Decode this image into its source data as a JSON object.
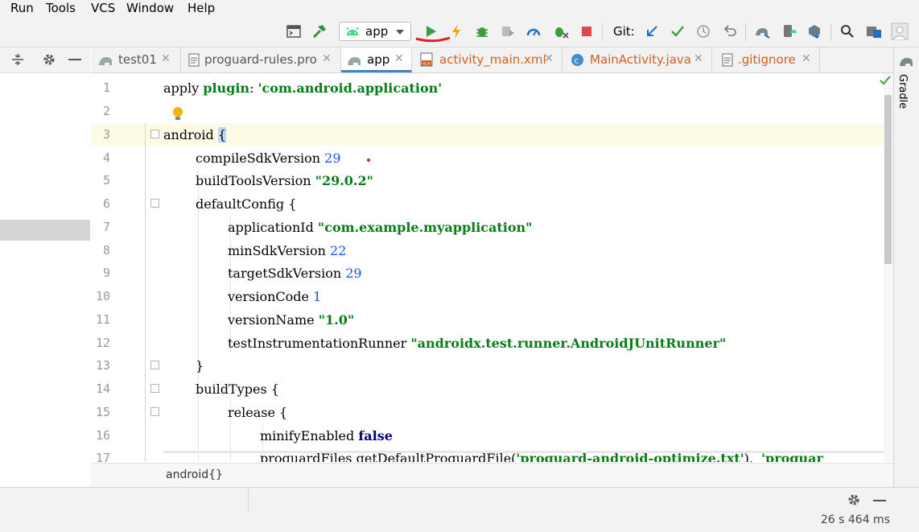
{
  "menu": [
    "Run",
    "Tools",
    "VCS",
    "Window",
    "Help"
  ],
  "toolbar": {
    "run_config": "app",
    "git_label": "Git:"
  },
  "tabs": [
    {
      "label": "test01",
      "icon": "gradle-elephant-icon",
      "active": false
    },
    {
      "label": "proguard-rules.pro",
      "icon": "file-icon",
      "active": false
    },
    {
      "label": "app",
      "icon": "gradle-elephant-icon",
      "active": true
    },
    {
      "label": "activity_main.xml",
      "icon": "xml-layout-icon",
      "active": false
    },
    {
      "label": "MainActivity.java",
      "icon": "java-class-icon",
      "active": false
    },
    {
      "label": ".gitignore",
      "icon": "file-icon",
      "active": false
    }
  ],
  "right_strip": {
    "gradle": "Gradle"
  },
  "editor": {
    "line_numbers": [
      "1",
      "2",
      "3",
      "4",
      "5",
      "6",
      "7",
      "8",
      "9",
      "10",
      "11",
      "12",
      "13",
      "14",
      "15",
      "16",
      "17"
    ],
    "lines": {
      "l1_a": "apply ",
      "l1_b": "plugin",
      "l1_c": ": ",
      "l1_d": "'com.android.application'",
      "l3_a": "android ",
      "l3_b": "{",
      "l4_a": "compileSdkVersion ",
      "l4_b": "29",
      "l5_a": "buildToolsVersion ",
      "l5_b": "\"29.0.2\"",
      "l6_a": "defaultConfig {",
      "l7_a": "applicationId ",
      "l7_b": "\"com.example.myapplication\"",
      "l8_a": "minSdkVersion ",
      "l8_b": "22",
      "l9_a": "targetSdkVersion ",
      "l9_b": "29",
      "l10_a": "versionCode ",
      "l10_b": "1",
      "l11_a": "versionName ",
      "l11_b": "\"1.0\"",
      "l12_a": "testInstrumentationRunner ",
      "l12_b": "\"androidx.test.runner.AndroidJUnitRunner\"",
      "l13_a": "}",
      "l14_a": "buildTypes {",
      "l15_a": "release {",
      "l16_a": "minifyEnabled ",
      "l16_b": "false",
      "l17_a": "proguardFiles getDefaultProguardFile(",
      "l17_b": "'proguard-android-optimize.txt'",
      "l17_c": "),  ",
      "l17_d": "'proguar"
    }
  },
  "breadcrumb": "android{}",
  "status": {
    "time": "26 s 464 ms"
  },
  "colors": {
    "accent": "#4083c9",
    "run_green": "#3c9f3c",
    "stop_red": "#d94b4b",
    "string_green": "#067d17",
    "number_blue": "#1750eb"
  }
}
